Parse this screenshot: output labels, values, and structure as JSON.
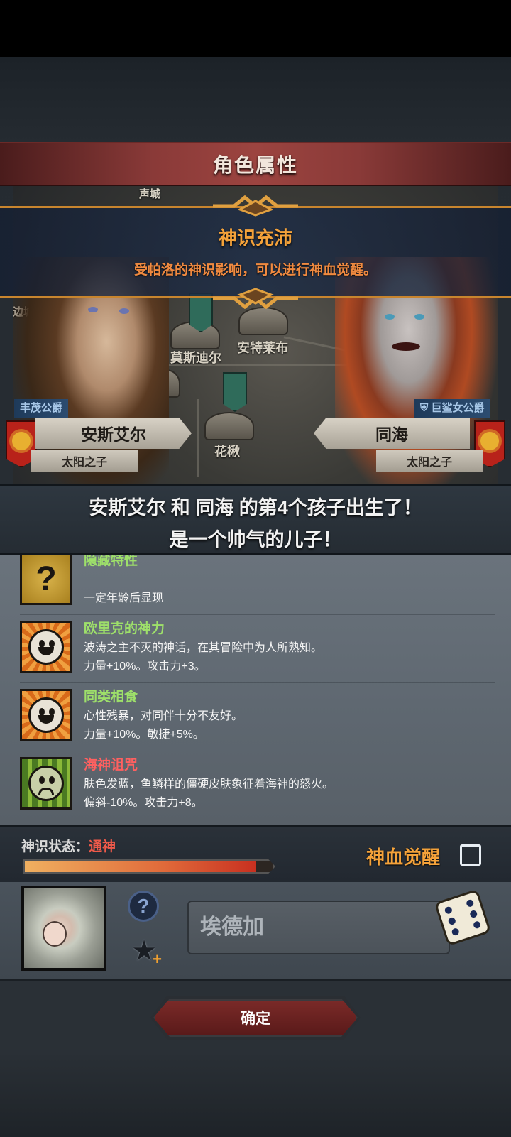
{
  "header": {
    "title": "角色属性"
  },
  "banner": {
    "title": "神识充沛",
    "text": "受帕洛的神识影响，可以进行神血觉醒。"
  },
  "map": {
    "labels": [
      "莫斯迪尔",
      "安特莱布",
      "花楸",
      "声城",
      "边城"
    ]
  },
  "parents": {
    "father": {
      "title": "丰茂公爵",
      "name": "安斯艾尔",
      "epithet": "太阳之子"
    },
    "mother": {
      "title": "巨鲨女公爵",
      "name": "同海",
      "epithet": "太阳之子"
    }
  },
  "announcement": {
    "line1": "安斯艾尔 和 同海 的第4个孩子出生了！",
    "line2": "是一个帅气的儿子！"
  },
  "traits": [
    {
      "name": "隐藏特性",
      "line1": "",
      "line2": "一定年龄后显现",
      "icon": "question-mark-icon",
      "color": "green"
    },
    {
      "name": "欧里克的神力",
      "line1": "波涛之主不灭的神话，在其冒险中为人所熟知。",
      "line2": "力量+10%。攻击力+3。",
      "icon": "happy-face-icon",
      "color": "green"
    },
    {
      "name": "同类相食",
      "line1": "心性残暴，对同伴十分不友好。",
      "line2": "力量+10%。敏捷+5%。",
      "icon": "happy-face-icon",
      "color": "green"
    },
    {
      "name": "海神诅咒",
      "line1": "肤色发蓝，鱼鳞样的僵硬皮肤象征着海神的怒火。",
      "line2": "偏斜-10%。攻击力+8。",
      "icon": "sad-face-icon",
      "color": "red"
    }
  ],
  "divine_state": {
    "label": "神识状态：",
    "value": "通神",
    "progress": 0.93,
    "awaken_label": "神血觉醒"
  },
  "child": {
    "name": "埃德加"
  },
  "confirm": {
    "label": "确定"
  }
}
